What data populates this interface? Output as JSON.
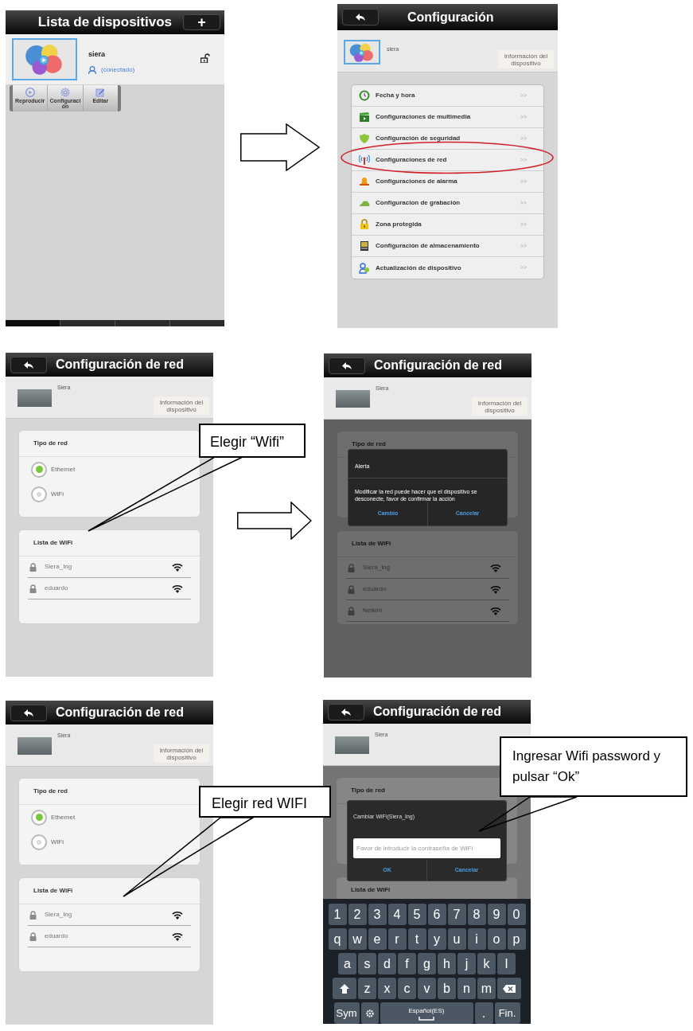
{
  "screens": [
    {
      "kind": "device_list",
      "title": "Lista de dispositivos",
      "add_button": "+",
      "device": {
        "thumbnail": {
          "kind": "logo"
        },
        "name": "siera",
        "status": "(conectado)"
      },
      "actions": [
        {
          "kind": "play",
          "label": "Reproducir"
        },
        {
          "kind": "gear",
          "label": "Configuraci\nón"
        },
        {
          "kind": "edit",
          "label": "Editar"
        }
      ]
    },
    {
      "kind": "settings_menu",
      "title": "Configuración",
      "device": {
        "thumbnail": {
          "kind": "logo"
        },
        "name": "siera"
      },
      "info_button": "Información del dispositivo",
      "items": [
        {
          "kind": "clock",
          "label": "Fecha y hora",
          "arrow": ">>",
          "highlighted": false
        },
        {
          "kind": "clapper",
          "label": "Configuraciones de multimedia",
          "arrow": ">>",
          "highlighted": false
        },
        {
          "kind": "shield",
          "label": "Configuración de seguridad",
          "arrow": ">>",
          "highlighted": false
        },
        {
          "kind": "antenna",
          "label": "Configuraciones de red",
          "arrow": ">>",
          "highlighted": true
        },
        {
          "kind": "bell",
          "label": "Configuraciones de alarma",
          "arrow": ">>",
          "highlighted": false
        },
        {
          "kind": "cloud",
          "label": "Configuracion de grabación",
          "arrow": ">>",
          "highlighted": false
        },
        {
          "kind": "padlock",
          "label": "Zona protegida",
          "arrow": ">>",
          "highlighted": false
        },
        {
          "kind": "storage",
          "label": "Configuración de almacenamiento",
          "arrow": ">>",
          "highlighted": false
        },
        {
          "kind": "people",
          "label": "Actualización de dispositivo",
          "arrow": ">>",
          "highlighted": false
        }
      ]
    },
    {
      "kind": "network_settings",
      "title": "Configuración de red",
      "device": {
        "thumbnail": {
          "kind": "photo"
        },
        "name": "Siera"
      },
      "info_button": "Información del dispositivo",
      "network_type": {
        "title": "Tipo de red",
        "options": [
          {
            "label": "Ethernet",
            "selected": true
          },
          {
            "label": "WiFi",
            "selected": false
          }
        ]
      },
      "wifi_list": {
        "title": "Lista de WiFi",
        "networks": [
          "Siera_Ing",
          "eduardo"
        ]
      }
    },
    {
      "kind": "network_settings",
      "title": "Configuración de red",
      "device": {
        "thumbnail": {
          "kind": "photo"
        },
        "name": "Siera"
      },
      "info_button": "Información del dispositivo",
      "network_type": {
        "title": "Tipo de red"
      },
      "wifi_list": {
        "title": "Lista de WiFi",
        "networks": [
          "Siera_Ing",
          "eduardo",
          "Neikim"
        ]
      },
      "dialog": {
        "kind": "alert",
        "title": "Alerta",
        "message": "Modificar la red puede hacer que el dispositivo se desconecte, favor de confirmar la acción",
        "buttons": [
          "Cambio",
          "Cancelar"
        ]
      }
    },
    {
      "kind": "network_settings",
      "title": "Configuración de red",
      "device": {
        "thumbnail": {
          "kind": "photo"
        },
        "name": "Siera"
      },
      "info_button": "Información del dispositivo",
      "network_type": {
        "title": "Tipo de red",
        "options": [
          {
            "label": "Ethernet",
            "selected": true
          },
          {
            "label": "WiFi",
            "selected": false
          }
        ]
      },
      "wifi_list": {
        "title": "Lista de WiFi",
        "networks": [
          "Siera_Ing",
          "eduardo"
        ]
      }
    },
    {
      "kind": "network_settings",
      "title": "Configuración de red",
      "device": {
        "thumbnail": {
          "kind": "photo"
        },
        "name": "Siera"
      },
      "network_type": {
        "title": "Tipo de red"
      },
      "wifi_list": {
        "title": "Lista de WiFi"
      },
      "dialog": {
        "kind": "input",
        "title": "Cambiar WiFi(Siera_Ing)",
        "placeholder": "Favor de introducir la contraseña de WiFi",
        "buttons": [
          "OK",
          "Cancelar"
        ]
      },
      "keyboard": {
        "rows": [
          {
            "keys": [
              {
                "label": "1"
              },
              {
                "label": "2"
              },
              {
                "label": "3"
              },
              {
                "label": "4"
              },
              {
                "label": "5"
              },
              {
                "label": "6"
              },
              {
                "label": "7"
              },
              {
                "label": "8"
              },
              {
                "label": "9"
              },
              {
                "label": "0"
              }
            ]
          },
          {
            "keys": [
              {
                "label": "q"
              },
              {
                "label": "w"
              },
              {
                "label": "e"
              },
              {
                "label": "r"
              },
              {
                "label": "t"
              },
              {
                "label": "y"
              },
              {
                "label": "u"
              },
              {
                "label": "i"
              },
              {
                "label": "o"
              },
              {
                "label": "p"
              }
            ]
          },
          {
            "keys": [
              {
                "label": "a"
              },
              {
                "label": "s"
              },
              {
                "label": "d"
              },
              {
                "label": "f"
              },
              {
                "label": "g"
              },
              {
                "label": "h"
              },
              {
                "label": "j"
              },
              {
                "label": "k"
              },
              {
                "label": "l"
              }
            ]
          },
          {
            "keys": [
              {
                "kind": "shift"
              },
              {
                "label": "z"
              },
              {
                "label": "x"
              },
              {
                "label": "c"
              },
              {
                "label": "v"
              },
              {
                "label": "b"
              },
              {
                "label": "n"
              },
              {
                "label": "m"
              },
              {
                "kind": "backspace"
              }
            ]
          },
          {
            "keys": [
              {
                "kind": "wide",
                "label": "Sym"
              },
              {
                "kind": "settings"
              },
              {
                "kind": "space",
                "label": "Español(ES)"
              },
              {
                "label": "."
              },
              {
                "kind": "wide",
                "label": "Fin."
              }
            ]
          }
        ]
      }
    }
  ],
  "callouts": [
    "Elegir “Wifi”",
    "Elegir red WIFI",
    "Ingresar Wifi password y pulsar “Ok”"
  ]
}
